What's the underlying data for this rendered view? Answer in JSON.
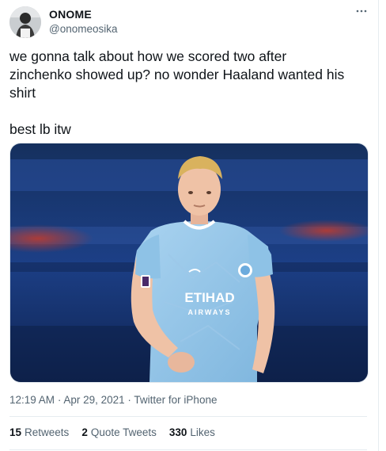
{
  "author": {
    "name": "ONOME",
    "handle": "@onomeosika"
  },
  "tweet": {
    "line1": "we gonna talk about how we scored two after",
    "line2": "zinchenko showed up? no wonder Haaland wanted his",
    "line3": "shirt",
    "line4": "best lb itw"
  },
  "media": {
    "kit_sponsor_line1": "ETIHAD",
    "kit_sponsor_line2": "AIRWAYS"
  },
  "meta": {
    "time": "12:19 AM",
    "dot1": "·",
    "date": "Apr 29, 2021",
    "dot2": "·",
    "source": "Twitter for iPhone"
  },
  "stats": {
    "retweets_count": "15",
    "retweets_label": "Retweets",
    "quotes_count": "2",
    "quotes_label": "Quote Tweets",
    "likes_count": "330",
    "likes_label": "Likes"
  },
  "icons": {
    "more": "more-horizontal-icon"
  }
}
